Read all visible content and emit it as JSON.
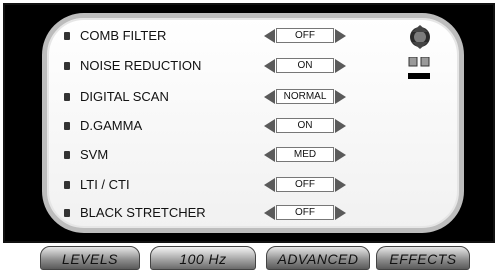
{
  "settings": [
    {
      "label": "COMB FILTER",
      "value": "OFF"
    },
    {
      "label": "NOISE REDUCTION",
      "value": "ON"
    },
    {
      "label": "DIGITAL SCAN",
      "value": "NORMAL"
    },
    {
      "label": "D.GAMMA",
      "value": "ON"
    },
    {
      "label": "SVM",
      "value": "MED"
    },
    {
      "label": "LTI / CTI",
      "value": "OFF"
    },
    {
      "label": "BLACK STRETCHER",
      "value": "OFF"
    }
  ],
  "tabs": [
    {
      "label": "LEVELS"
    },
    {
      "label": "100 Hz"
    },
    {
      "label": "ADVANCED"
    },
    {
      "label": "EFFECTS"
    }
  ],
  "icons": {
    "top_right": "tv-remote-icon",
    "arrows": "triangle-arrow-icon"
  }
}
